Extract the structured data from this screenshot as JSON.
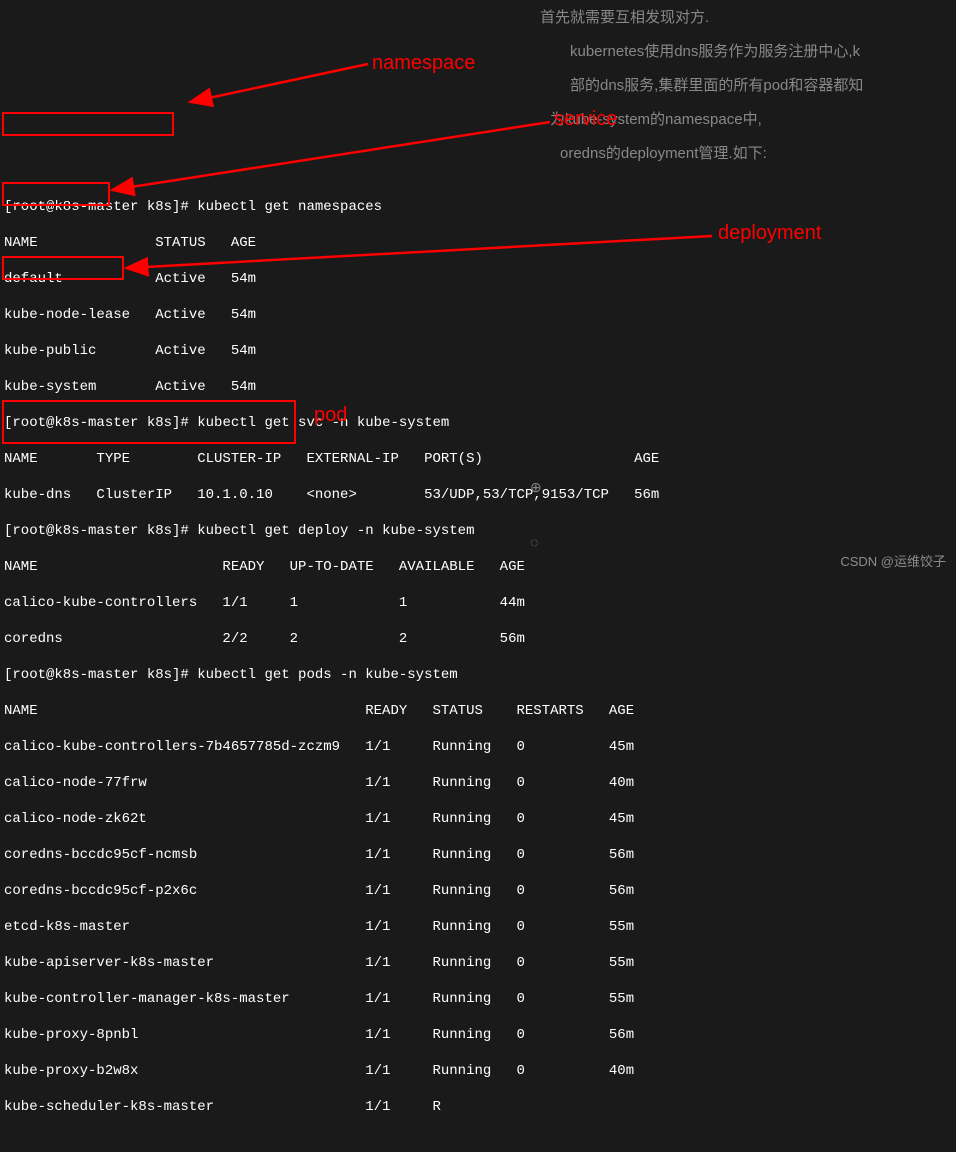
{
  "bg_text": {
    "l1": "首先就需要互相发现对方.",
    "l2": "kubernetes使用dns服务作为服务注册中心,k",
    "l3": "部的dns服务,集群里面的所有pod和容器都知",
    "l4": "为kube-system的namespace中,",
    "l5": "oredns的deployment管理.如下:"
  },
  "prompts": {
    "p1": "[root@k8s-master k8s]# ",
    "p2": "[root@k8s-master k8s]# ",
    "p3": "[root@k8s-master k8s]# ",
    "p4": "[root@k8s-master k8s]# "
  },
  "cmds": {
    "c1": "kubectl get namespaces",
    "c2": "kubectl get svc -n kube-system",
    "c3": "kubectl get deploy -n kube-system",
    "c4": "kubectl get pods -n kube-system"
  },
  "ns": {
    "hdr": "NAME              STATUS   AGE",
    "r1": "default           Active   54m",
    "r2": "kube-node-lease   Active   54m",
    "r3": "kube-public       Active   54m",
    "r4": "kube-system       Active   54m"
  },
  "svc": {
    "hdr": "NAME       TYPE        CLUSTER-IP   EXTERNAL-IP   PORT(S)                  AGE",
    "r1": "kube-dns   ClusterIP   10.1.0.10    <none>        53/UDP,53/TCP,9153/TCP   56m"
  },
  "deploy": {
    "hdr": "NAME                      READY   UP-TO-DATE   AVAILABLE   AGE",
    "r1": "calico-kube-controllers   1/1     1            1           44m",
    "r2": "coredns                   2/2     2            2           56m"
  },
  "pods": {
    "hdr": "NAME                                       READY   STATUS    RESTARTS   AGE",
    "r1": "calico-kube-controllers-7b4657785d-zczm9   1/1     Running   0          45m",
    "r2": "calico-node-77frw                          1/1     Running   0          40m",
    "r3": "calico-node-zk62t                          1/1     Running   0          45m",
    "r4": "coredns-bccdc95cf-ncmsb                    1/1     Running   0          56m",
    "r5": "coredns-bccdc95cf-p2x6c                    1/1     Running   0          56m",
    "r6": "etcd-k8s-master                            1/1     Running   0          55m",
    "r7": "kube-apiserver-k8s-master                  1/1     Running   0          55m",
    "r8": "kube-controller-manager-k8s-master         1/1     Running   0          55m",
    "r9": "kube-proxy-8pnbl                           1/1     Running   0          56m",
    "r10": "kube-proxy-b2w8x                           1/1     Running   0          40m",
    "r11": "kube-scheduler-k8s-master                  1/1     R"
  },
  "ann": {
    "namespace": "namespace",
    "service": "service",
    "deployment": "deployment",
    "pod": "pod"
  },
  "watermark": "CSDN @运维饺子"
}
